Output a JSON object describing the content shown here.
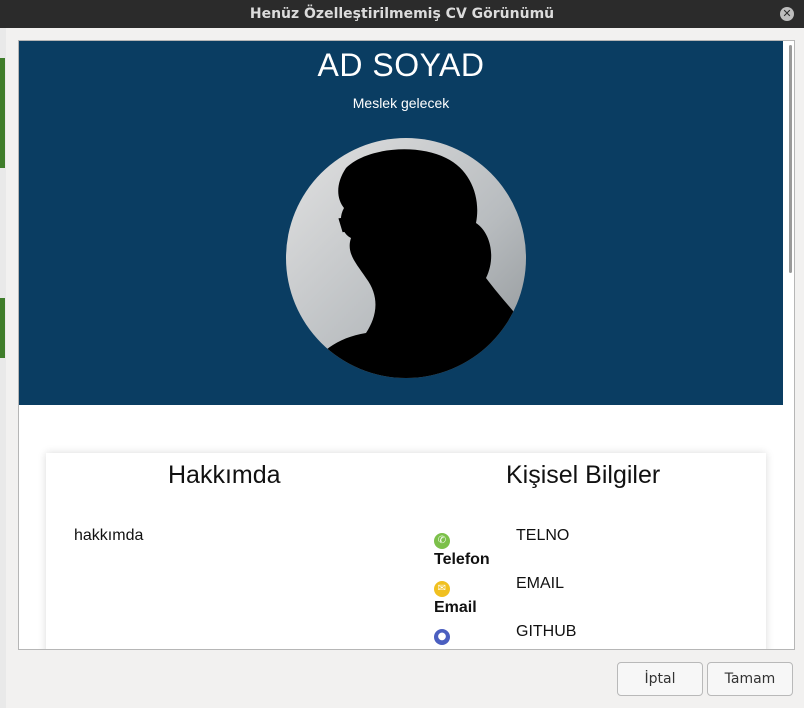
{
  "window": {
    "title": "Henüz Özelleştirilmemiş CV Görünümü"
  },
  "header": {
    "name": "AD SOYAD",
    "subtitle": "Meslek gelecek",
    "background_color": "#0a3d62"
  },
  "about": {
    "title": "Hakkımda",
    "text": "hakkımda"
  },
  "personal": {
    "title": "Kişisel Bilgiler",
    "items": [
      {
        "icon": "phone-icon",
        "label": "Telefon",
        "value": "TELNO",
        "color": "#7cc04a"
      },
      {
        "icon": "email-icon",
        "label": "Email",
        "value": "EMAIL",
        "color": "#f0c020"
      },
      {
        "icon": "github-icon",
        "label": "",
        "value": "GITHUB",
        "color": "#4b5fc0"
      }
    ]
  },
  "buttons": {
    "cancel": "İptal",
    "ok": "Tamam"
  }
}
